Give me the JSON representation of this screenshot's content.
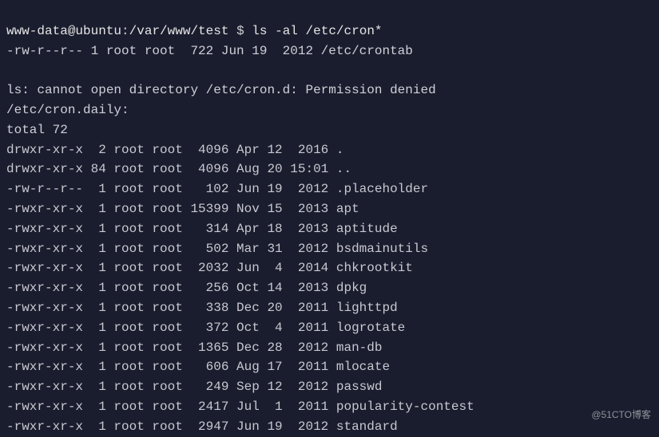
{
  "prompt": {
    "userhost": "www-data@ubuntu",
    "cwd": "/var/www/test",
    "symbol": "$",
    "command": "ls -al /etc/cron*"
  },
  "crontab_line": "-rw-r--r-- 1 root root  722 Jun 19  2012 /etc/crontab",
  "error_line": "ls: cannot open directory /etc/cron.d: Permission denied",
  "daily_header": "/etc/cron.daily:",
  "total_line": "total 72",
  "listing": [
    {
      "perms": "drwxr-xr-x",
      "links": " 2",
      "owner": "root",
      "group": "root",
      "size": " 4096",
      "month": "Apr",
      "day": "12",
      "yeartime": " 2016",
      "name": "."
    },
    {
      "perms": "drwxr-xr-x",
      "links": "84",
      "owner": "root",
      "group": "root",
      "size": " 4096",
      "month": "Aug",
      "day": "20",
      "yeartime": "15:01",
      "name": ".."
    },
    {
      "perms": "-rw-r--r--",
      "links": " 1",
      "owner": "root",
      "group": "root",
      "size": "  102",
      "month": "Jun",
      "day": "19",
      "yeartime": " 2012",
      "name": ".placeholder"
    },
    {
      "perms": "-rwxr-xr-x",
      "links": " 1",
      "owner": "root",
      "group": "root",
      "size": "15399",
      "month": "Nov",
      "day": "15",
      "yeartime": " 2013",
      "name": "apt"
    },
    {
      "perms": "-rwxr-xr-x",
      "links": " 1",
      "owner": "root",
      "group": "root",
      "size": "  314",
      "month": "Apr",
      "day": "18",
      "yeartime": " 2013",
      "name": "aptitude"
    },
    {
      "perms": "-rwxr-xr-x",
      "links": " 1",
      "owner": "root",
      "group": "root",
      "size": "  502",
      "month": "Mar",
      "day": "31",
      "yeartime": " 2012",
      "name": "bsdmainutils"
    },
    {
      "perms": "-rwxr-xr-x",
      "links": " 1",
      "owner": "root",
      "group": "root",
      "size": " 2032",
      "month": "Jun",
      "day": " 4",
      "yeartime": " 2014",
      "name": "chkrootkit"
    },
    {
      "perms": "-rwxr-xr-x",
      "links": " 1",
      "owner": "root",
      "group": "root",
      "size": "  256",
      "month": "Oct",
      "day": "14",
      "yeartime": " 2013",
      "name": "dpkg"
    },
    {
      "perms": "-rwxr-xr-x",
      "links": " 1",
      "owner": "root",
      "group": "root",
      "size": "  338",
      "month": "Dec",
      "day": "20",
      "yeartime": " 2011",
      "name": "lighttpd"
    },
    {
      "perms": "-rwxr-xr-x",
      "links": " 1",
      "owner": "root",
      "group": "root",
      "size": "  372",
      "month": "Oct",
      "day": " 4",
      "yeartime": " 2011",
      "name": "logrotate"
    },
    {
      "perms": "-rwxr-xr-x",
      "links": " 1",
      "owner": "root",
      "group": "root",
      "size": " 1365",
      "month": "Dec",
      "day": "28",
      "yeartime": " 2012",
      "name": "man-db"
    },
    {
      "perms": "-rwxr-xr-x",
      "links": " 1",
      "owner": "root",
      "group": "root",
      "size": "  606",
      "month": "Aug",
      "day": "17",
      "yeartime": " 2011",
      "name": "mlocate"
    },
    {
      "perms": "-rwxr-xr-x",
      "links": " 1",
      "owner": "root",
      "group": "root",
      "size": "  249",
      "month": "Sep",
      "day": "12",
      "yeartime": " 2012",
      "name": "passwd"
    },
    {
      "perms": "-rwxr-xr-x",
      "links": " 1",
      "owner": "root",
      "group": "root",
      "size": " 2417",
      "month": "Jul",
      "day": " 1",
      "yeartime": " 2011",
      "name": "popularity-contest"
    },
    {
      "perms": "-rwxr-xr-x",
      "links": " 1",
      "owner": "root",
      "group": "root",
      "size": " 2947",
      "month": "Jun",
      "day": "19",
      "yeartime": " 2012",
      "name": "standard"
    }
  ],
  "watermark": "@51CTO博客"
}
